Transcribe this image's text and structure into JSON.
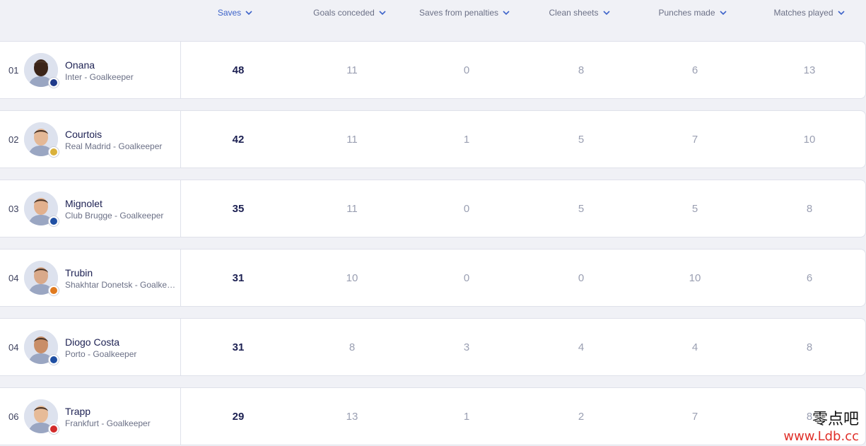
{
  "columns": [
    {
      "label": "Saves",
      "active": true
    },
    {
      "label": "Goals conceded",
      "active": false
    },
    {
      "label": "Saves from penalties",
      "active": false
    },
    {
      "label": "Clean sheets",
      "active": false
    },
    {
      "label": "Punches made",
      "active": false
    },
    {
      "label": "Matches played",
      "active": false
    }
  ],
  "players": [
    {
      "rank": "01",
      "name": "Onana",
      "subtitle": "Inter - Goalkeeper",
      "stats": [
        "48",
        "11",
        "0",
        "8",
        "6",
        "13"
      ],
      "skin": "#3b2418",
      "club_color": "#1f3a8a"
    },
    {
      "rank": "02",
      "name": "Courtois",
      "subtitle": "Real Madrid - Goalkeeper",
      "stats": [
        "42",
        "11",
        "1",
        "5",
        "7",
        "10"
      ],
      "skin": "#e4b896",
      "club_color": "#d9b13b"
    },
    {
      "rank": "03",
      "name": "Mignolet",
      "subtitle": "Club Brugge - Goalkeeper",
      "stats": [
        "35",
        "11",
        "0",
        "5",
        "5",
        "8"
      ],
      "skin": "#e2b08d",
      "club_color": "#1f4fa3"
    },
    {
      "rank": "04",
      "name": "Trubin",
      "subtitle": "Shakhtar Donetsk - Goalkeeper",
      "stats": [
        "31",
        "10",
        "0",
        "0",
        "10",
        "6"
      ],
      "skin": "#d9a98a",
      "club_color": "#e07a1f"
    },
    {
      "rank": "04",
      "name": "Diogo Costa",
      "subtitle": "Porto - Goalkeeper",
      "stats": [
        "31",
        "8",
        "3",
        "4",
        "4",
        "8"
      ],
      "skin": "#c98e68",
      "club_color": "#1f4fa3"
    },
    {
      "rank": "06",
      "name": "Trapp",
      "subtitle": "Frankfurt - Goalkeeper",
      "stats": [
        "29",
        "13",
        "1",
        "2",
        "7",
        "8"
      ],
      "skin": "#e7bb98",
      "club_color": "#d22b2b"
    }
  ],
  "watermark": {
    "cn": "零点吧",
    "url": "www.Ldb.cc"
  }
}
